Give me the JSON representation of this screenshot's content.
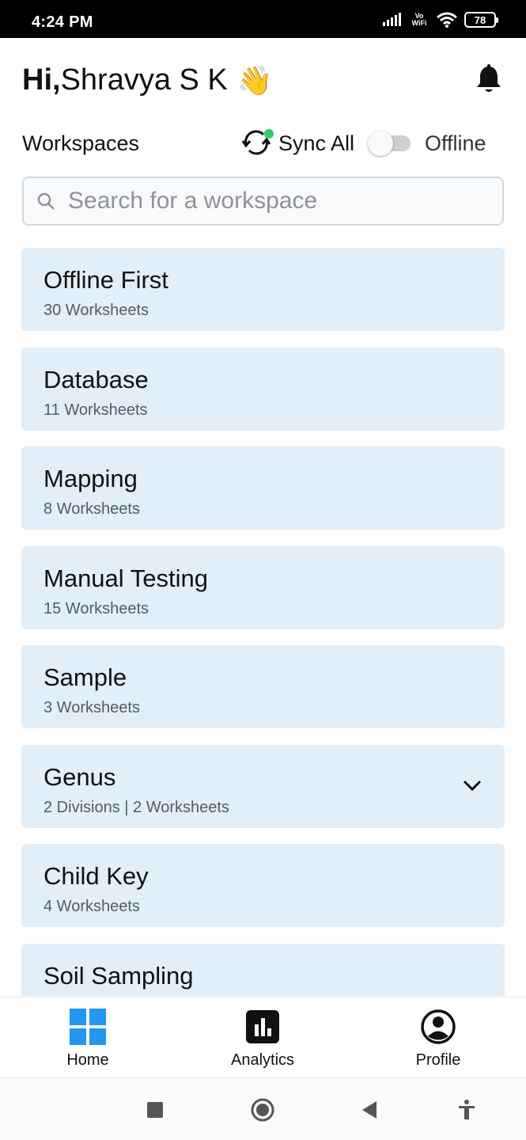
{
  "status_bar": {
    "time": "4:24 PM",
    "network_label": "Vo WiFi",
    "battery": "78",
    "icons": [
      "signal-icon",
      "wifi-icon",
      "battery-icon"
    ]
  },
  "header": {
    "greeting_prefix": "Hi,",
    "user_name": "Shravya S K",
    "wave_emoji": "👋",
    "bell_icon": "notification-bell-icon"
  },
  "workspaces_bar": {
    "title": "Workspaces",
    "sync_label": "Sync All",
    "sync_status_color": "#2ecc71",
    "offline_label": "Offline",
    "offline_enabled": false
  },
  "search": {
    "placeholder": "Search for a workspace"
  },
  "workspaces": [
    {
      "name": "Offline First",
      "meta": "30 Worksheets",
      "expandable": false
    },
    {
      "name": "Database",
      "meta": "11 Worksheets",
      "expandable": false
    },
    {
      "name": "Mapping",
      "meta": "8 Worksheets",
      "expandable": false
    },
    {
      "name": "Manual Testing",
      "meta": "15 Worksheets",
      "expandable": false
    },
    {
      "name": "Sample",
      "meta": "3 Worksheets",
      "expandable": false
    },
    {
      "name": "Genus",
      "meta": "2 Divisions | 2 Worksheets",
      "expandable": true
    },
    {
      "name": "Child Key",
      "meta": "4 Worksheets",
      "expandable": false
    },
    {
      "name": "Soil Sampling",
      "meta": "",
      "expandable": false
    }
  ],
  "bottom_nav": {
    "active": "home",
    "accent_color": "#2196f3",
    "items": [
      {
        "label": "Home",
        "icon": "home-grid-icon"
      },
      {
        "label": "Analytics",
        "icon": "analytics-icon"
      },
      {
        "label": "Profile",
        "icon": "profile-icon"
      }
    ]
  },
  "colors": {
    "card_background": "#e2eff8",
    "search_border": "#cdd9e4"
  }
}
